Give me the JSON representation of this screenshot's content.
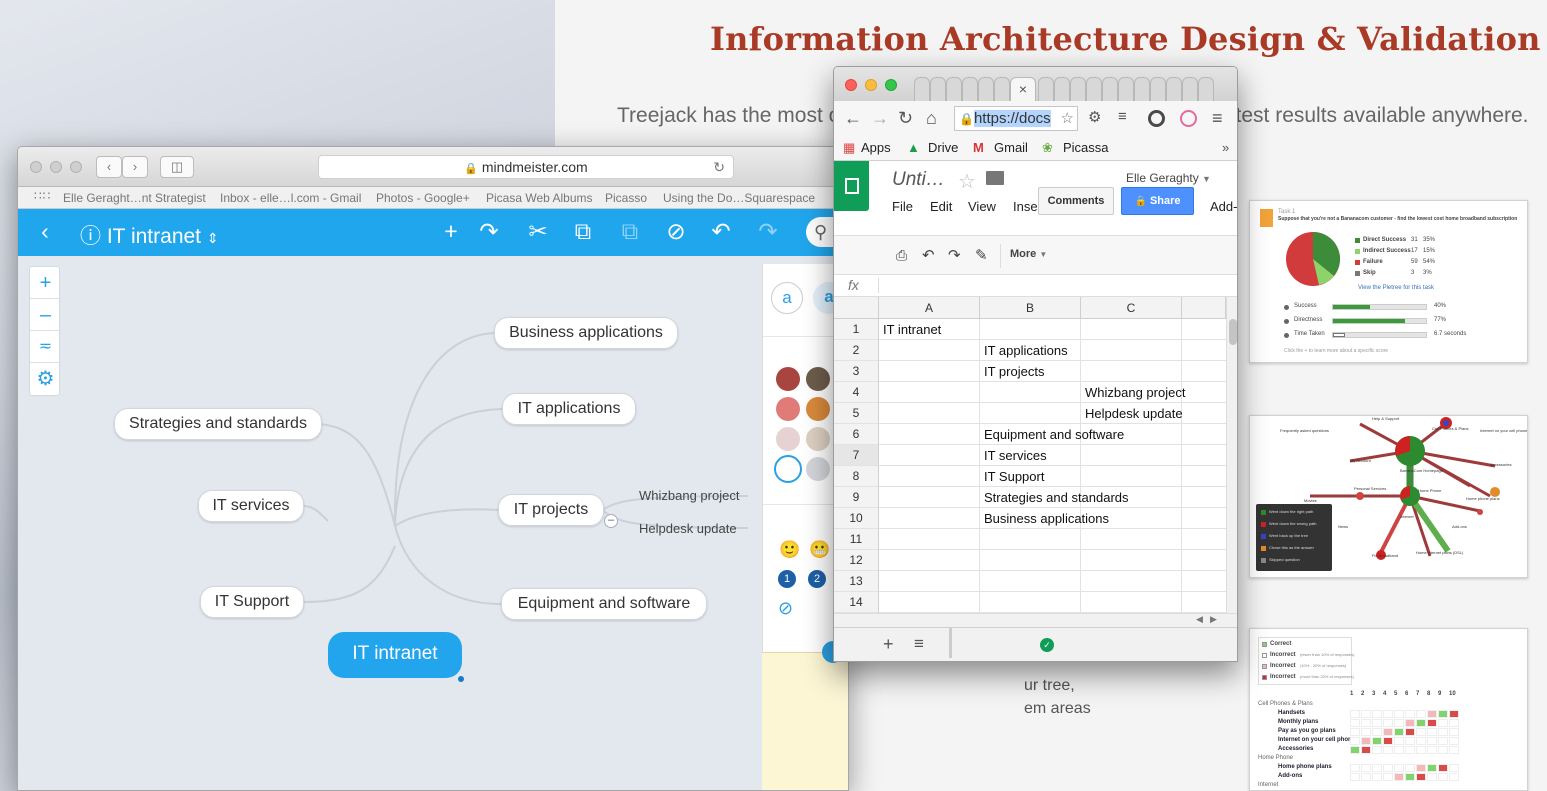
{
  "website": {
    "title": "Information Architecture Design & Validation",
    "subtitle_left": "Treejack has the most c",
    "subtitle_right": "e test results available anywhere.",
    "body_line1": "ur tree,",
    "body_line2": "em areas",
    "card1": {
      "task_label": "Task 1",
      "question": "Suppose that you're not a Bananacom customer - find the lowest cost home broadband subscription",
      "legend": [
        {
          "label": "Direct Success",
          "count": "31",
          "pct": "35%",
          "color": "#3d8c3a"
        },
        {
          "label": "Indirect Success",
          "count": "17",
          "pct": "15%",
          "color": "#8cd36a"
        },
        {
          "label": "Failure",
          "count": "59",
          "pct": "54%",
          "color": "#d13b3b"
        },
        {
          "label": "Skip",
          "count": "3",
          "pct": "3%",
          "color": "#777777"
        }
      ],
      "link": "View the Pietree for this task",
      "metrics": [
        {
          "label": "Success",
          "value": "40%",
          "level": 0.4
        },
        {
          "label": "Directness",
          "value": "77%",
          "level": 0.77
        },
        {
          "label": "Time Taken",
          "value": "6.7 seconds",
          "level": 0.13
        }
      ],
      "footnote": "Click the + to learn more about a specific score"
    },
    "card2": {
      "nodes": [
        "Help & Support",
        "Frequently asked questions",
        "Cell Phones & Plans",
        "Internet on your cell phone",
        "My Account",
        "BananaCom Homepage",
        "Accessories",
        "Personal Services",
        "Home Phone",
        "Home phone plans",
        "Movies",
        "News",
        "Add-ons",
        "Internet",
        "Fix Broadband",
        "Home internet plans (DSL)"
      ],
      "legend": [
        "Went down the right path",
        "Went down the wrong path",
        "Went back up the tree",
        "Chose this as the answer",
        "Skipped question"
      ]
    },
    "card3": {
      "legend": [
        "Correct",
        "Incorrect",
        "Incorrect",
        "Incorrect"
      ],
      "legend_notes": [
        "",
        "(fewer than 10% of responses)",
        "(10% - 20% of responses)",
        "(more than 20% of responses)"
      ],
      "columns": [
        "1",
        "2",
        "3",
        "4",
        "5",
        "6",
        "7",
        "8",
        "9",
        "10"
      ],
      "rows": [
        "Cell Phones & Plans",
        "Handsets",
        "Monthly plans",
        "Pay as you go plans",
        "Internet on your cell phone",
        "Accessories",
        "Home Phone",
        "Home phone plans",
        "Add-ons",
        "Internet"
      ]
    }
  },
  "safari": {
    "url": "mindmeister.com",
    "favorites": [
      "Elle Geraght…nt Strategist",
      "Inbox - elle…l.com - Gmail",
      "Photos - Google+",
      "Picasa Web Albums",
      "Picasso",
      "Using the Do…Squarespace"
    ],
    "map_title": "IT intranet",
    "root": "IT intranet",
    "nodes": {
      "business_applications": "Business applications",
      "it_applications": "IT applications",
      "it_projects": "IT projects",
      "equipment_software": "Equipment and software",
      "strategies_standards": "Strategies and standards",
      "it_services": "IT services",
      "it_support": "IT Support",
      "whizbang": "Whizbang project",
      "helpdesk": "Helpdesk update"
    },
    "style_panel": {
      "font_a": "a",
      "colors": [
        "#a84540",
        "#6d5d4b",
        "#e07b78",
        "#d88a3c",
        "#e6d2d0",
        "#ddd0c2",
        "#ffffff",
        "#d3d6da"
      ],
      "icons": [
        "smiley-icon",
        "grin-icon",
        "number-1-icon",
        "number-2-icon",
        "prohibited-icon"
      ]
    }
  },
  "chrome": {
    "omnibox": "https://docs",
    "bookmarks": [
      "Apps",
      "Drive",
      "Gmail",
      "Picassa"
    ],
    "bookmarks_more": "»",
    "doc_title": "Unti…",
    "user": "Elle Geraghty",
    "menus": [
      "File",
      "Edit",
      "View",
      "Inse"
    ],
    "menu_addons": "Add-",
    "comments_label": "Comments",
    "share_label": "Share",
    "more_label": "More",
    "fx_label": "fx",
    "columns": [
      "A",
      "B",
      "C"
    ],
    "rows": [
      "1",
      "2",
      "3",
      "4",
      "5",
      "6",
      "7",
      "8",
      "9",
      "10",
      "11",
      "12",
      "13",
      "14"
    ],
    "cells": {
      "A1": "IT intranet",
      "B2": "IT applications",
      "B3": "IT projects",
      "C4": "Whizbang project",
      "C5": "Helpdesk update",
      "B6": "Equipment and software",
      "B7": "IT services",
      "B8": "IT Support",
      "B9": "Strategies and standards",
      "B10": "Business applications"
    }
  }
}
